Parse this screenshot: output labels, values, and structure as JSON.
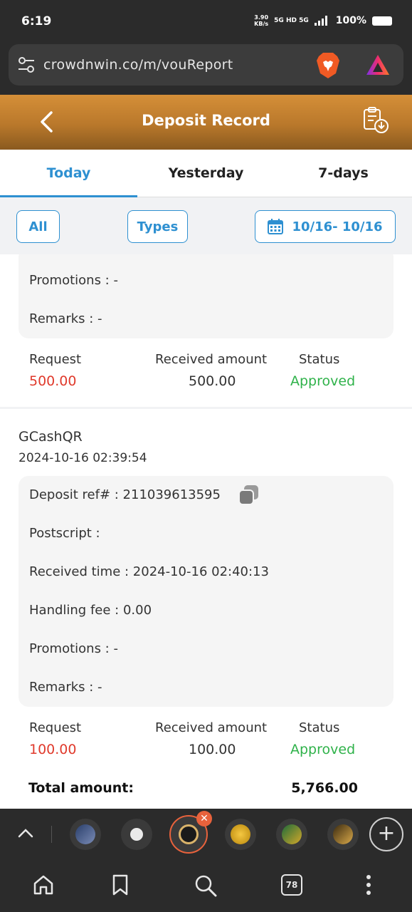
{
  "status_bar": {
    "time": "6:19",
    "speed_value": "3.90",
    "speed_unit": "KB/s",
    "network": "5G HD 5G",
    "battery": "100%"
  },
  "browser": {
    "url": "crowdnwin.co/m/vouReport",
    "tab_count": "78"
  },
  "header": {
    "title": "Deposit Record"
  },
  "tabs": [
    {
      "label": "Today",
      "active": true
    },
    {
      "label": "Yesterday",
      "active": false
    },
    {
      "label": "7-days",
      "active": false
    }
  ],
  "filters": {
    "all_label": "All",
    "types_label": "Types",
    "date_range": "10/16- 10/16"
  },
  "records": [
    {
      "promotions": "Promotions : -",
      "remarks": "Remarks : -",
      "request_label": "Request",
      "request_value": "500.00",
      "received_label": "Received amount",
      "received_value": "500.00",
      "status_label": "Status",
      "status_value": "Approved"
    },
    {
      "method": "GCashQR",
      "datetime": "2024-10-16 02:39:54",
      "deposit_ref": "Deposit ref# : 211039613595",
      "postscript": "Postscript :",
      "received_time": "Received time : 2024-10-16 02:40:13",
      "handling_fee": "Handling fee : 0.00",
      "promotions": "Promotions : -",
      "remarks": "Remarks : -",
      "request_label": "Request",
      "request_value": "100.00",
      "received_label": "Received amount",
      "received_value": "100.00",
      "status_label": "Status",
      "status_value": "Approved"
    }
  ],
  "totals": {
    "label": "Total amount:",
    "value": "5,766.00"
  },
  "colors": {
    "accent": "#2e90d1",
    "header_gold": "#c58433",
    "request_red": "#e03a2c",
    "approved_green": "#2fb24a",
    "close_orange": "#e8623c"
  },
  "icons": [
    "tune-icon",
    "brave-lion-icon",
    "triangle-rewards-icon",
    "back-arrow-icon",
    "clipboard-download-icon",
    "calendar-icon",
    "copy-icon",
    "chevron-up-icon",
    "close-icon",
    "plus-icon",
    "home-icon",
    "bookmark-icon",
    "search-icon",
    "more-vertical-icon"
  ]
}
